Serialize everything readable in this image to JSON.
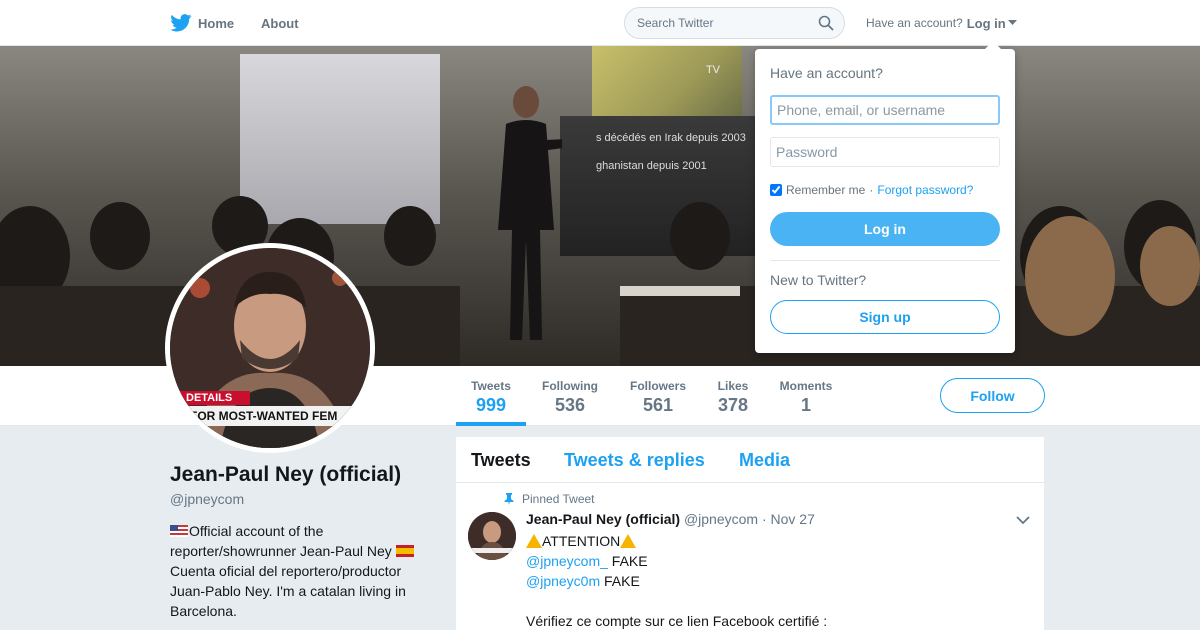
{
  "nav": {
    "home_label": "Home",
    "about_label": "About",
    "search_placeholder": "Search Twitter",
    "have_account": "Have an account?",
    "login_label": "Log in"
  },
  "header_photo": {
    "slide_lines": [
      "s décédés en Irak depuis 2003",
      "ghanistan depuis 2001"
    ],
    "tv_mark": "TV"
  },
  "avatar": {
    "caption_top": "DETAILS",
    "caption_bottom": "FOR MOST-WANTED FEM"
  },
  "stats": [
    {
      "label": "Tweets",
      "value": "999",
      "active": true
    },
    {
      "label": "Following",
      "value": "536"
    },
    {
      "label": "Followers",
      "value": "561"
    },
    {
      "label": "Likes",
      "value": "378"
    },
    {
      "label": "Moments",
      "value": "1"
    }
  ],
  "follow_label": "Follow",
  "profile": {
    "name": "Jean-Paul Ney (official)",
    "handle": "@jpneycom",
    "bio_part1": "Official account of the reporter/showrunner Jean-Paul Ney",
    "bio_part2": "Cuenta oficial del reportero/productor Juan-Pablo Ney. I'm a catalan living in Barcelona."
  },
  "timeline": {
    "tabs": [
      "Tweets",
      "Tweets & replies",
      "Media"
    ],
    "pinned_label": "Pinned Tweet",
    "tweet": {
      "name": "Jean-Paul Ney (official)",
      "handle": "@jpneycom",
      "date": "· Nov 27",
      "line1": "ATTENTION",
      "mention1": "@jpneycom_",
      "fake1": " FAKE",
      "mention2": "@jpneyc0m",
      "fake2": " FAKE",
      "line4": "Vérifiez ce compte sur ce lien Facebook certifié :"
    }
  },
  "login_dropdown": {
    "title": "Have an account?",
    "username_placeholder": "Phone, email, or username",
    "password_placeholder": "Password",
    "remember_label": "Remember me",
    "separator": " · ",
    "forgot_label": "Forgot password?",
    "login_button": "Log in",
    "new_label": "New to Twitter?",
    "signup_button": "Sign up"
  },
  "colors": {
    "accent": "#1da1f2",
    "login_button": "#4ab3f4",
    "background": "#e6ecf0"
  }
}
